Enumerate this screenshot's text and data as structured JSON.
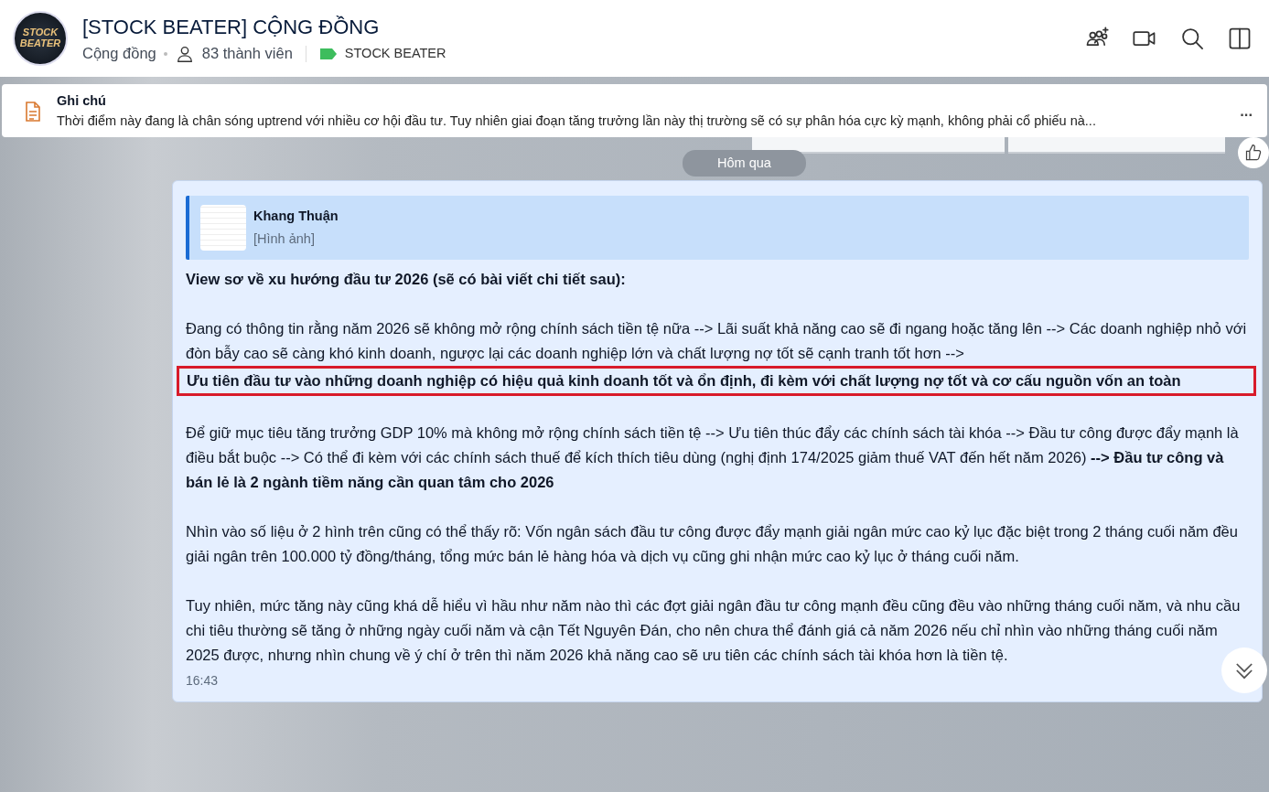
{
  "header": {
    "avatar_text": "STOCK BEATER",
    "title": "[STOCK BEATER] CỘNG ĐỒNG",
    "type": "Cộng đồng",
    "members": "83 thành viên",
    "tag": {
      "label": "STOCK BEATER",
      "color": "#3dbd5d"
    }
  },
  "note": {
    "title": "Ghi chú",
    "text": "Thời điểm này đang là chân sóng uptrend với nhiều cơ hội đầu tư. Tuy nhiên giai đoạn tăng trưởng lần này thị trường sẽ có sự phân hóa cực kỳ mạnh, không phải cổ phiếu nà...",
    "menu": "..."
  },
  "date_divider": "Hôm qua",
  "message": {
    "quote": {
      "author": "Khang Thuận",
      "content": "[Hình ảnh]"
    },
    "paragraphs": [
      {
        "kind": "bold",
        "text": "View sơ về xu hướng đầu tư 2026 (sẽ có bài viết chi tiết sau):"
      },
      {
        "kind": "plain",
        "text": "Đang có thông tin rằng năm 2026 sẽ không mở rộng chính sách tiền tệ nữa  --> Lãi suất khả năng cao sẽ đi ngang hoặc tăng lên --> Các doanh nghiệp nhỏ với đòn bẫy cao sẽ càng khó kinh doanh, ngược lại các doanh nghiệp lớn và chất lượng nợ tốt sẽ cạnh tranh tốt hơn -->"
      },
      {
        "kind": "boxed",
        "text": "Ưu tiên đầu tư vào những doanh nghiệp có hiệu quả kinh doanh tốt và ổn định, đi kèm với chất lượng nợ tốt và cơ cấu nguồn vốn an toàn"
      },
      {
        "kind": "plain",
        "text": "Để giữ mục tiêu tăng trưởng GDP 10% mà không mở rộng chính sách tiền tệ --> Ưu tiên thúc đẩy các chính sách tài khóa --> Đầu tư công được đẩy mạnh là điều bắt buộc --> Có thể đi kèm với các chính sách thuế để kích thích tiêu dùng (nghị định 174/2025 giảm thuế VAT đến hết năm 2026) **--> Đầu tư công và bán lẻ là 2 ngành tiềm năng cần quan tâm cho 2026**"
      },
      {
        "kind": "plain",
        "text": "Nhìn vào số liệu ở 2 hình trên cũng có thể thấy rõ: Vốn ngân sách đầu tư công được đẩy mạnh giải ngân mức cao kỷ lục đặc biệt trong 2 tháng cuối năm đều giải ngân trên 100.000 tỷ đồng/tháng, tổng mức bán lẻ hàng hóa và dịch vụ cũng ghi nhận mức cao kỷ lục ở tháng cuối năm."
      },
      {
        "kind": "plain",
        "text": "Tuy nhiên, mức tăng này cũng khá dễ hiểu vì hầu như năm nào thì các đợt giải ngân đầu tư công mạnh đều cũng đều vào những tháng cuối năm, và nhu cầu chi tiêu thường sẽ tăng ở những ngày cuối năm và cận Tết Nguyên Đán, cho nên chưa thể đánh giá cả năm 2026 nếu chỉ nhìn vào những tháng cuối năm 2025 được, nhưng nhìn chung về ý chí ở trên thì năm 2026 khả năng cao sẽ ưu tiên các chính sách tài khóa hơn là tiền tệ."
      }
    ],
    "time": "16:43"
  }
}
